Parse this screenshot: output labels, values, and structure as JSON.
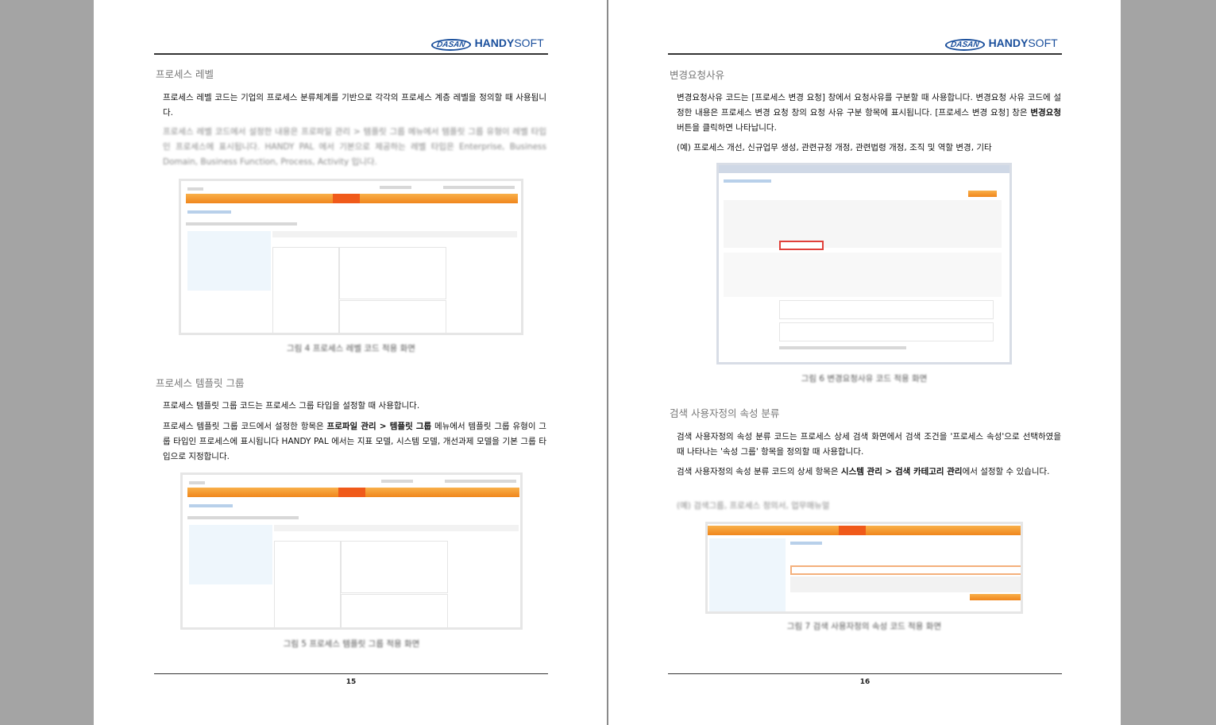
{
  "logo": {
    "dasan": "DASAN",
    "handy": "HANDY",
    "soft": "SOFT"
  },
  "page15": {
    "section1": {
      "heading": "프로세스 레벨",
      "para1": "프로세스 레벨 코드는 기업의 프로세스 분류체계를 기반으로 각각의 프로세스 계층 레벨을 정의할 때 사용됩니다.",
      "para2": "프로세스 레벨 코드에서 설정한 내용은 프로파일 관리 > 템플릿 그룹 메뉴에서 템플릿 그룹 유형이 레벨 타입인 프로세스에 표시됩니다. HANDY PAL 에서 기본으로 제공하는 레벨 타입은 Enterprise, Business Domain, Business Function, Process, Activity 입니다.",
      "caption": "그림 4 프로세스 레벨 코드 적용 화면"
    },
    "section2": {
      "heading": "프로세스 템플릿 그룹",
      "para1": "프로세스 템플릿 그룹 코드는 프로세스 그룹 타입을 설정할 때 사용합니다.",
      "para2_a": "프로세스 템플릿 그룹 코드에서 설정한 항목은 ",
      "para2_bold": "프로파일 관리 > 템플릿 그룹",
      "para2_b": " 메뉴에서 템플릿 그룹 유형이 그룹 타입인 프로세스에 표시됩니다 HANDY PAL 에서는 지표 모델, 시스템 모델, 개선과제 모델을 기본 그룹 타입으로 지정합니다.",
      "caption": "그림 5 프로세스 템플릿 그룹 적용 화면"
    },
    "page_number": "15"
  },
  "page16": {
    "section1": {
      "heading": "변경요청사유",
      "para1_a": "변경요청사유 코드는 [프로세스 변경 요청] 창에서 요청사유를 구분할 때 사용합니다. 변경요청 사유 코드에 설정한 내용은 프로세스 변경 요청 창의 요청 사유 구분 항목에 표시됩니다. [프로세스 변경 요청] 창은 ",
      "para1_bold": "변경요청",
      "para1_b": " 버튼을 클릭하면 나타납니다.",
      "example": "(예) 프로세스 개선, 신규업무 생성, 관련규정 개정, 관련법령 개정, 조직 및 역할 변경, 기타",
      "caption": "그림 6 변경요청사유 코드 적용 화면"
    },
    "section2": {
      "heading": "검색 사용자정의 속성 분류",
      "para1": "검색 사용자정의 속성 분류 코드는 프로세스 상세 검색 화면에서 검색 조건을 '프로세스 속성'으로 선택하였을 때 나타나는 '속성 그룹' 항목을 정의할 때 사용합니다.",
      "para2_a": "검색 사용자정의 속성 분류 코드의 상세 항목은 ",
      "para2_bold": "시스템 관리 > 검색 카테고리 관리",
      "para2_b": "에서 설정할 수 있습니다.",
      "example": "(예) 검색그룹, 프로세스 정의서, 업무매뉴얼",
      "caption": "그림 7 검색 사용자정의 속성 코드 적용 화면"
    },
    "page_number": "16"
  },
  "colors": {
    "brand": "#1a4f9c",
    "menu_orange": "#f0861c",
    "heading_gray": "#777777"
  }
}
